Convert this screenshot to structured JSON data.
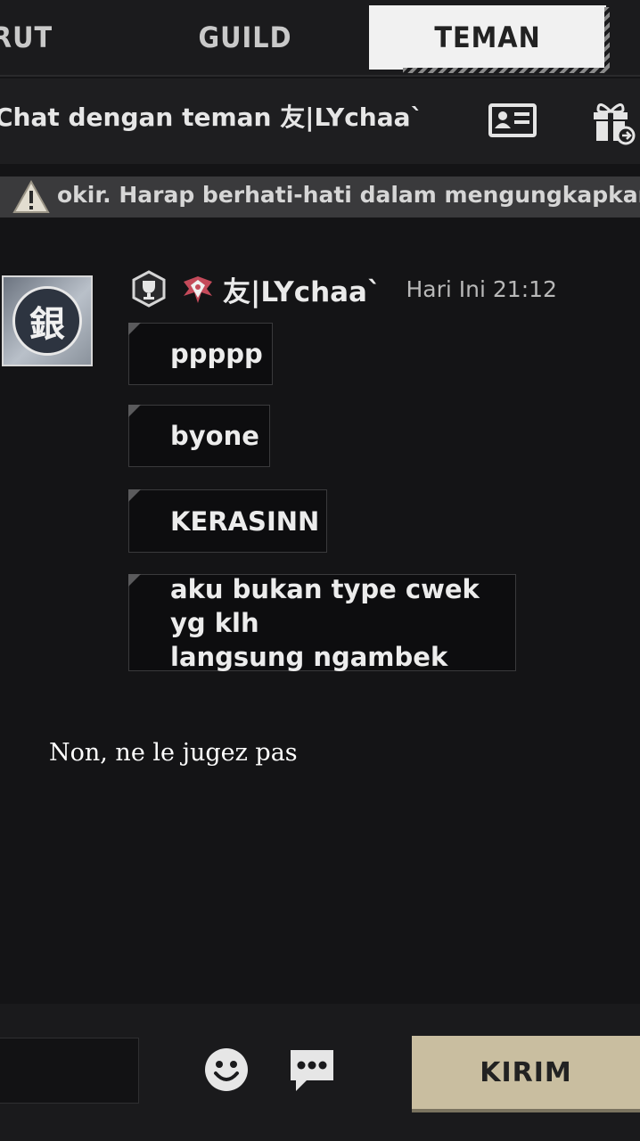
{
  "tabs": [
    {
      "label": "RUT"
    },
    {
      "label": "GUILD"
    },
    {
      "label": "TEMAN"
    }
  ],
  "header": {
    "title": "Chat dengan teman 友|LYchaa`"
  },
  "warning": {
    "text": "okir. Harap berhati-hati dalam mengungkapkan infor"
  },
  "message_group": {
    "avatar_glyph": "銀",
    "sender": "友|LYchaa`",
    "time": "Hari Ini 21:12",
    "messages": [
      {
        "text": "ppppp"
      },
      {
        "text": "byone"
      },
      {
        "text": "KERASINN"
      },
      {
        "line1": "aku bukan type cwek yg klh",
        "line2": "langsung ngambek"
      }
    ]
  },
  "caption": "Non, ne le jugez pas",
  "bottom": {
    "send_label": "KIRIM",
    "input_placeholder": ""
  },
  "colors": {
    "background": "#141416",
    "send_button": "#c9bea0",
    "active_tab": "#f1f1f1"
  },
  "icons": [
    "contact-card-icon",
    "gift-icon",
    "warning-icon",
    "trophy-badge-icon",
    "rank-badge-icon",
    "emoji-icon",
    "quick-chat-icon"
  ]
}
